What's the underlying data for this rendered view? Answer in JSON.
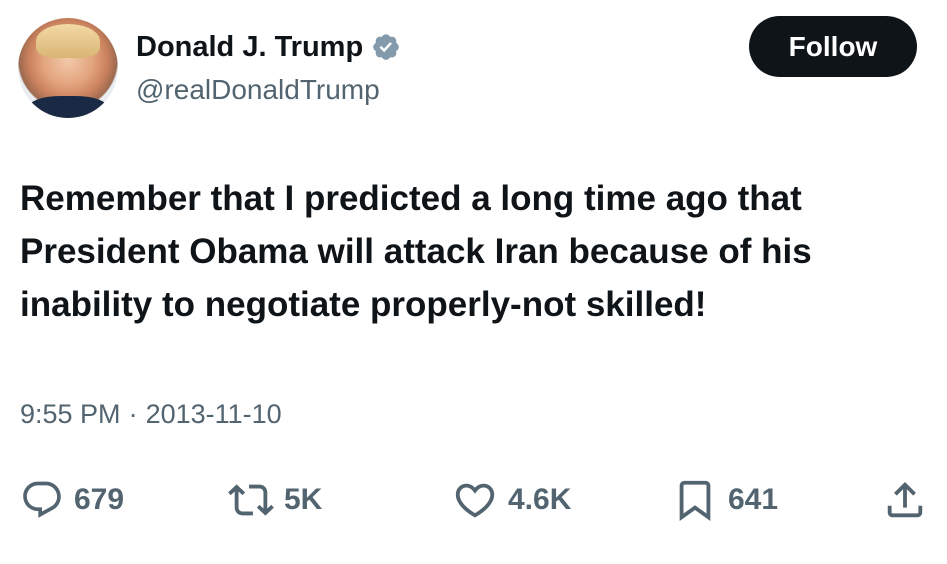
{
  "author": {
    "name": "Donald J. Trump",
    "handle": "@realDonaldTrump",
    "verified": true,
    "verified_color": "#829aab"
  },
  "follow_label": "Follow",
  "tweet": {
    "text": "Remember that I predicted a long time ago that\nPresident Obama will attack Iran because of his\ninability to negotiate properly-not skilled!"
  },
  "meta": {
    "time": "9:55 PM",
    "separator": "·",
    "date": "2013-11-10"
  },
  "actions": {
    "replies": {
      "icon": "reply-icon",
      "count": "679"
    },
    "retweets": {
      "icon": "retweet-icon",
      "count": "5K"
    },
    "likes": {
      "icon": "heart-icon",
      "count": "4.6K"
    },
    "bookmarks": {
      "icon": "bookmark-icon",
      "count": "641"
    },
    "share": {
      "icon": "share-icon"
    }
  },
  "colors": {
    "text_primary": "#0f1419",
    "text_secondary": "#536471",
    "button_bg": "#0f1419",
    "button_text": "#ffffff"
  }
}
